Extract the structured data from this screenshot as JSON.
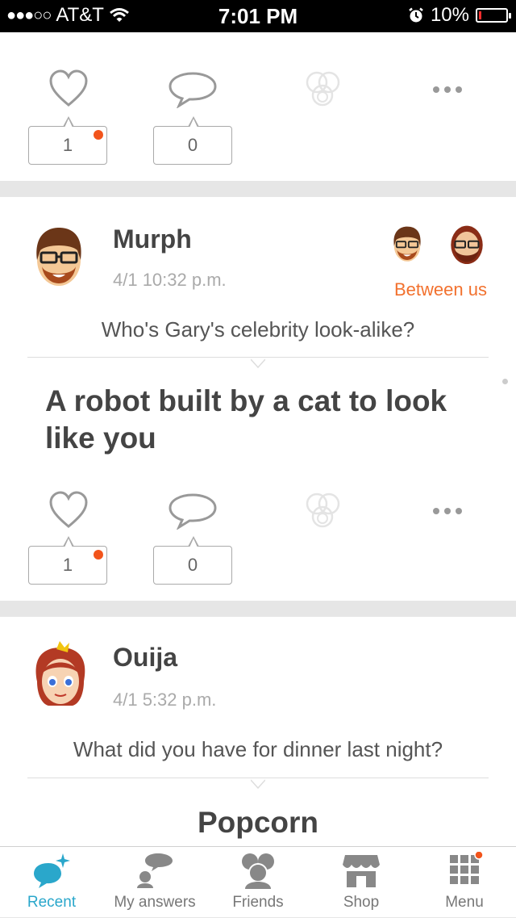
{
  "status_bar": {
    "carrier": "AT&T",
    "signal_dots": "●●●○○",
    "time": "7:01 PM",
    "battery": "10%",
    "battery_level": 0.1
  },
  "posts": [
    {
      "likes": "1",
      "comments": "0"
    },
    {
      "author": "Murph",
      "date": "4/1 10:32 p.m.",
      "audience": "Between us",
      "question": "Who's Gary's celebrity look-alike?",
      "answer": "A robot built by a cat to look like you",
      "likes": "1",
      "comments": "0"
    },
    {
      "author": "Ouija",
      "date": "4/1 5:32 p.m.",
      "question": "What did you have for dinner last night?",
      "answer": "Popcorn"
    }
  ],
  "tabs": [
    {
      "label": "Recent",
      "icon": "recent-bubble-icon"
    },
    {
      "label": "My answers",
      "icon": "my-answers-icon"
    },
    {
      "label": "Friends",
      "icon": "friends-icon"
    },
    {
      "label": "Shop",
      "icon": "shop-icon"
    },
    {
      "label": "Menu",
      "icon": "menu-grid-icon"
    }
  ],
  "colors": {
    "accent": "#2aa7cb",
    "notification": "#f2541b",
    "audience": "#f2712e"
  }
}
